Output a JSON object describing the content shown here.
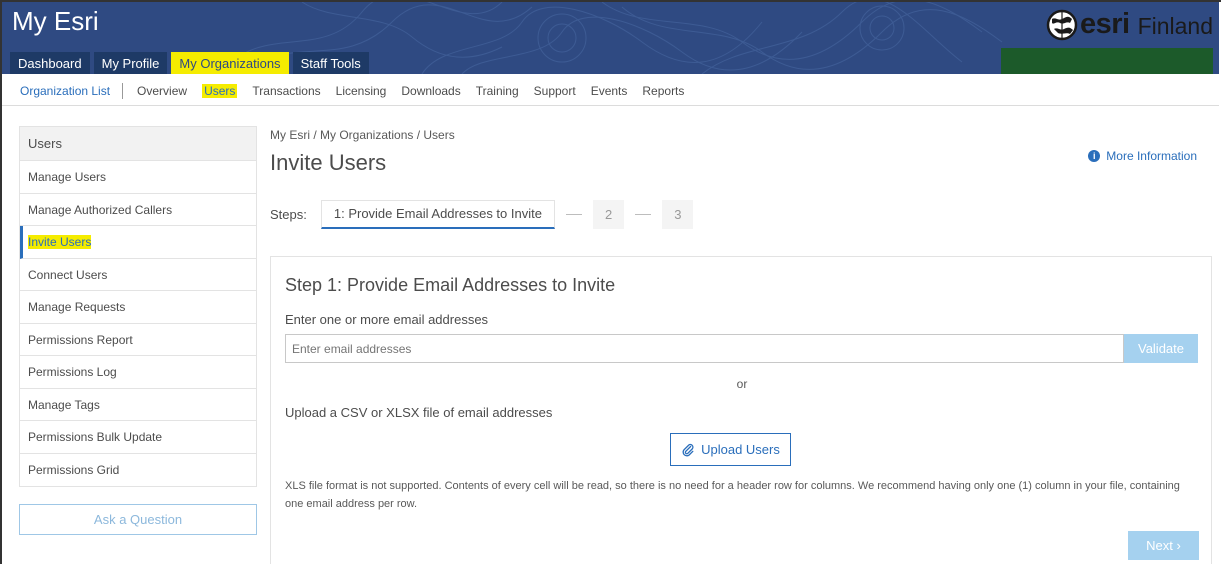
{
  "header": {
    "app_title": "My Esri",
    "brand": "esri",
    "brand_country": "Finland",
    "tabs": [
      {
        "label": "Dashboard",
        "active": false
      },
      {
        "label": "My Profile",
        "active": false
      },
      {
        "label": "My Organizations",
        "active": true
      },
      {
        "label": "Staff Tools",
        "active": false
      }
    ]
  },
  "subnav": {
    "org_list": "Organization List",
    "items": [
      "Overview",
      "Users",
      "Transactions",
      "Licensing",
      "Downloads",
      "Training",
      "Support",
      "Events",
      "Reports"
    ],
    "active": "Users"
  },
  "sidebar": {
    "heading": "Users",
    "items": [
      "Manage Users",
      "Manage Authorized Callers",
      "Invite Users",
      "Connect Users",
      "Manage Requests",
      "Permissions Report",
      "Permissions Log",
      "Manage Tags",
      "Permissions Bulk Update",
      "Permissions Grid"
    ],
    "active": "Invite Users",
    "ask_button": "Ask a Question"
  },
  "main": {
    "breadcrumb": "My Esri / My Organizations / Users",
    "title": "Invite Users",
    "more_info": "More Information",
    "steps_label": "Steps:",
    "steps": [
      "1: Provide Email Addresses to Invite",
      "2",
      "3"
    ],
    "panel": {
      "title": "Step 1: Provide Email Addresses to Invite",
      "email_label": "Enter one or more email addresses",
      "email_placeholder": "Enter email addresses",
      "validate": "Validate",
      "or": "or",
      "upload_label": "Upload a CSV or XLSX file of email addresses",
      "upload_button": "Upload Users",
      "note": "XLS file format is not supported. Contents of every cell will be read, so there is no need for a header row for columns. We recommend having only one (1) column in your file, containing one email address per row.",
      "next": "Next"
    }
  },
  "colors": {
    "banner": "#2f4a82",
    "highlight": "#f5ec00",
    "accent": "#2a6ebb",
    "disabled_button": "#a5d1ef"
  }
}
